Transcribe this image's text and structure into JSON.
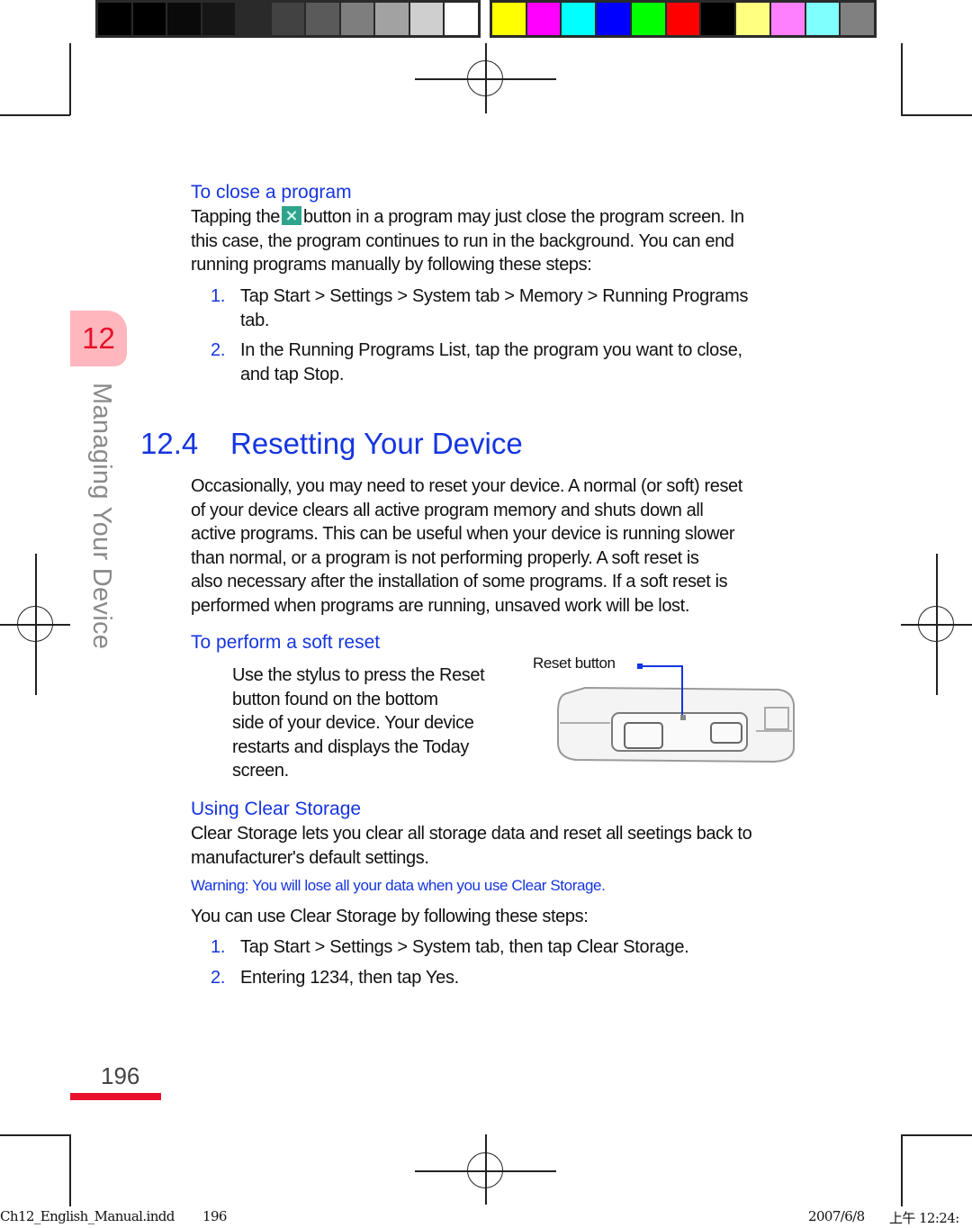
{
  "color_bars": {
    "grayscale": [
      "#000000",
      "#000000",
      "#0a0a0a",
      "#161616",
      "#2a2a2a",
      "#424242",
      "#5a5a5a",
      "#7e7e7e",
      "#a2a2a2",
      "#cfcfcf",
      "#ffffff"
    ],
    "process": [
      "#ffff00",
      "#ff00ff",
      "#00ffff",
      "#0000ff",
      "#00ff00",
      "#ff0000",
      "#000000",
      "#ffff80",
      "#ff80ff",
      "#80ffff",
      "#808080"
    ]
  },
  "chapter": {
    "number": "12",
    "title": "Managing Your Device"
  },
  "close_program": {
    "heading": "To close a program",
    "intro_before_icon": "Tapping the",
    "icon": "close-x-icon",
    "intro_after_icon_line1": "button in a program may just close the program screen. In",
    "intro_line2": "this case, the program continues to run in the background. You can end",
    "intro_line3": "running programs manually by following these steps:",
    "steps": [
      {
        "num": "1.",
        "line1": "Tap Start > Settings > System tab > Memory > Running Programs",
        "line2": "tab."
      },
      {
        "num": "2.",
        "line1": "In the Running Programs List, tap the program you want to close,",
        "line2": "and tap Stop."
      }
    ]
  },
  "section": {
    "number": "12.4",
    "title": "Resetting Your Device",
    "paragraph": [
      "Occasionally, you may need to reset your device. A normal (or soft) reset",
      "of your device clears all active program memory and shuts down all",
      "active programs. This can be useful when your device is running slower",
      "than normal, or a program is not performing properly. A soft reset is",
      "also necessary after the installation of some programs. If a soft reset is",
      "performed when programs are running, unsaved work will be lost."
    ]
  },
  "soft_reset": {
    "heading": "To perform a soft reset",
    "lines": [
      "Use the stylus to press the Reset",
      "button found on the bottom",
      "side of your device. Your device",
      "restarts and displays the Today",
      "screen."
    ],
    "figure_callout": "Reset button",
    "accent_color": "#1535e0"
  },
  "clear_storage": {
    "heading": "Using Clear Storage",
    "description": [
      "Clear Storage lets you clear all storage data and reset all seetings back to",
      "manufacturer's default settings."
    ],
    "warning": "Warning: You will lose all your data when you use Clear Storage.",
    "intro": "You can use Clear Storage by following these steps:",
    "steps": [
      {
        "num": "1.",
        "text": "Tap Start > Settings > System tab, then tap Clear Storage."
      },
      {
        "num": "2.",
        "text": "Entering 1234, then tap Yes."
      }
    ]
  },
  "footer": {
    "page_number": "196",
    "slug_file": "Ch12_English_Manual.indd",
    "slug_page": "196",
    "slug_date": "2007/6/8",
    "slug_time": "上午 12:24:"
  }
}
